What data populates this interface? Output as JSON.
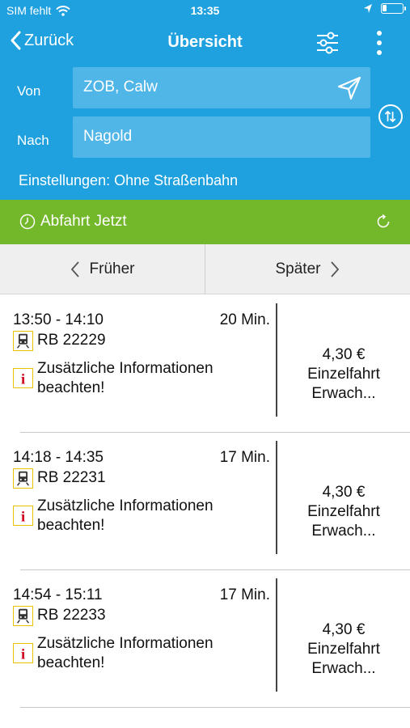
{
  "status_bar": {
    "carrier": "SIM fehlt",
    "time": "13:35"
  },
  "nav": {
    "back_label": "Zurück",
    "title": "Übersicht"
  },
  "route": {
    "from_label": "Von",
    "from_value": "ZOB, Calw",
    "to_label": "Nach",
    "to_value": "Nagold",
    "settings_text": "Einstellungen: Ohne Straßenbahn"
  },
  "departure": {
    "label": "Abfahrt",
    "value": "Jetzt"
  },
  "pager": {
    "earlier_label": "Früher",
    "later_label": "Später"
  },
  "trips": [
    {
      "times": "13:50 - 14:10",
      "duration": "20 Min.",
      "line": "RB 22229",
      "info_line1": "Zusätzliche Informationen",
      "info_line2": "beachten!",
      "price": "4,30 €",
      "fare_line1": "Einzelfahrt",
      "fare_line2": "Erwach..."
    },
    {
      "times": "14:18 - 14:35",
      "duration": "17 Min.",
      "line": "RB 22231",
      "info_line1": "Zusätzliche Informationen",
      "info_line2": "beachten!",
      "price": "4,30 €",
      "fare_line1": "Einzelfahrt",
      "fare_line2": "Erwach..."
    },
    {
      "times": "14:54 - 15:11",
      "duration": "17 Min.",
      "line": "RB 22233",
      "info_line1": "Zusätzliche Informationen",
      "info_line2": "beachten!",
      "price": "4,30 €",
      "fare_line1": "Einzelfahrt",
      "fare_line2": "Erwach..."
    }
  ],
  "colors": {
    "header_blue": "#1fa1e0",
    "departure_green": "#73b72a",
    "icon_yellow": "#e8c400",
    "info_red": "#d0021b"
  },
  "icons": {
    "train": "train-icon",
    "info": "info-icon",
    "clock": "clock-icon",
    "refresh": "refresh-icon",
    "send": "location-arrow-icon",
    "swap": "swap-icon",
    "filter": "filter-icon",
    "more": "more-icon"
  }
}
